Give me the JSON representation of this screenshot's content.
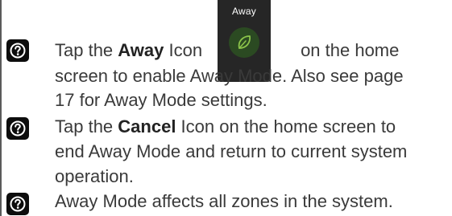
{
  "away_tile": {
    "label": "Away",
    "icon": "leaf-icon",
    "background_color": "#262626",
    "icon_circle_color": "#2b4a22",
    "icon_color": "#8bc34a"
  },
  "notes": [
    {
      "icon": "help-circle-icon",
      "line1_pre": "Tap the ",
      "line1_bold": "Away",
      "line1_mid": " Icon",
      "line1_post": "on the home",
      "line2": "screen to enable Away Mode. Also see page",
      "line3": "17 for Away Mode settings."
    },
    {
      "icon": "help-circle-icon",
      "line1_pre": "Tap the ",
      "line1_bold": "Cancel",
      "line1_post": " Icon on the home screen to",
      "line2": "end Away Mode and return to current system",
      "line3": "operation."
    },
    {
      "icon": "help-circle-icon",
      "line1": "Away Mode affects all zones in the system."
    }
  ]
}
